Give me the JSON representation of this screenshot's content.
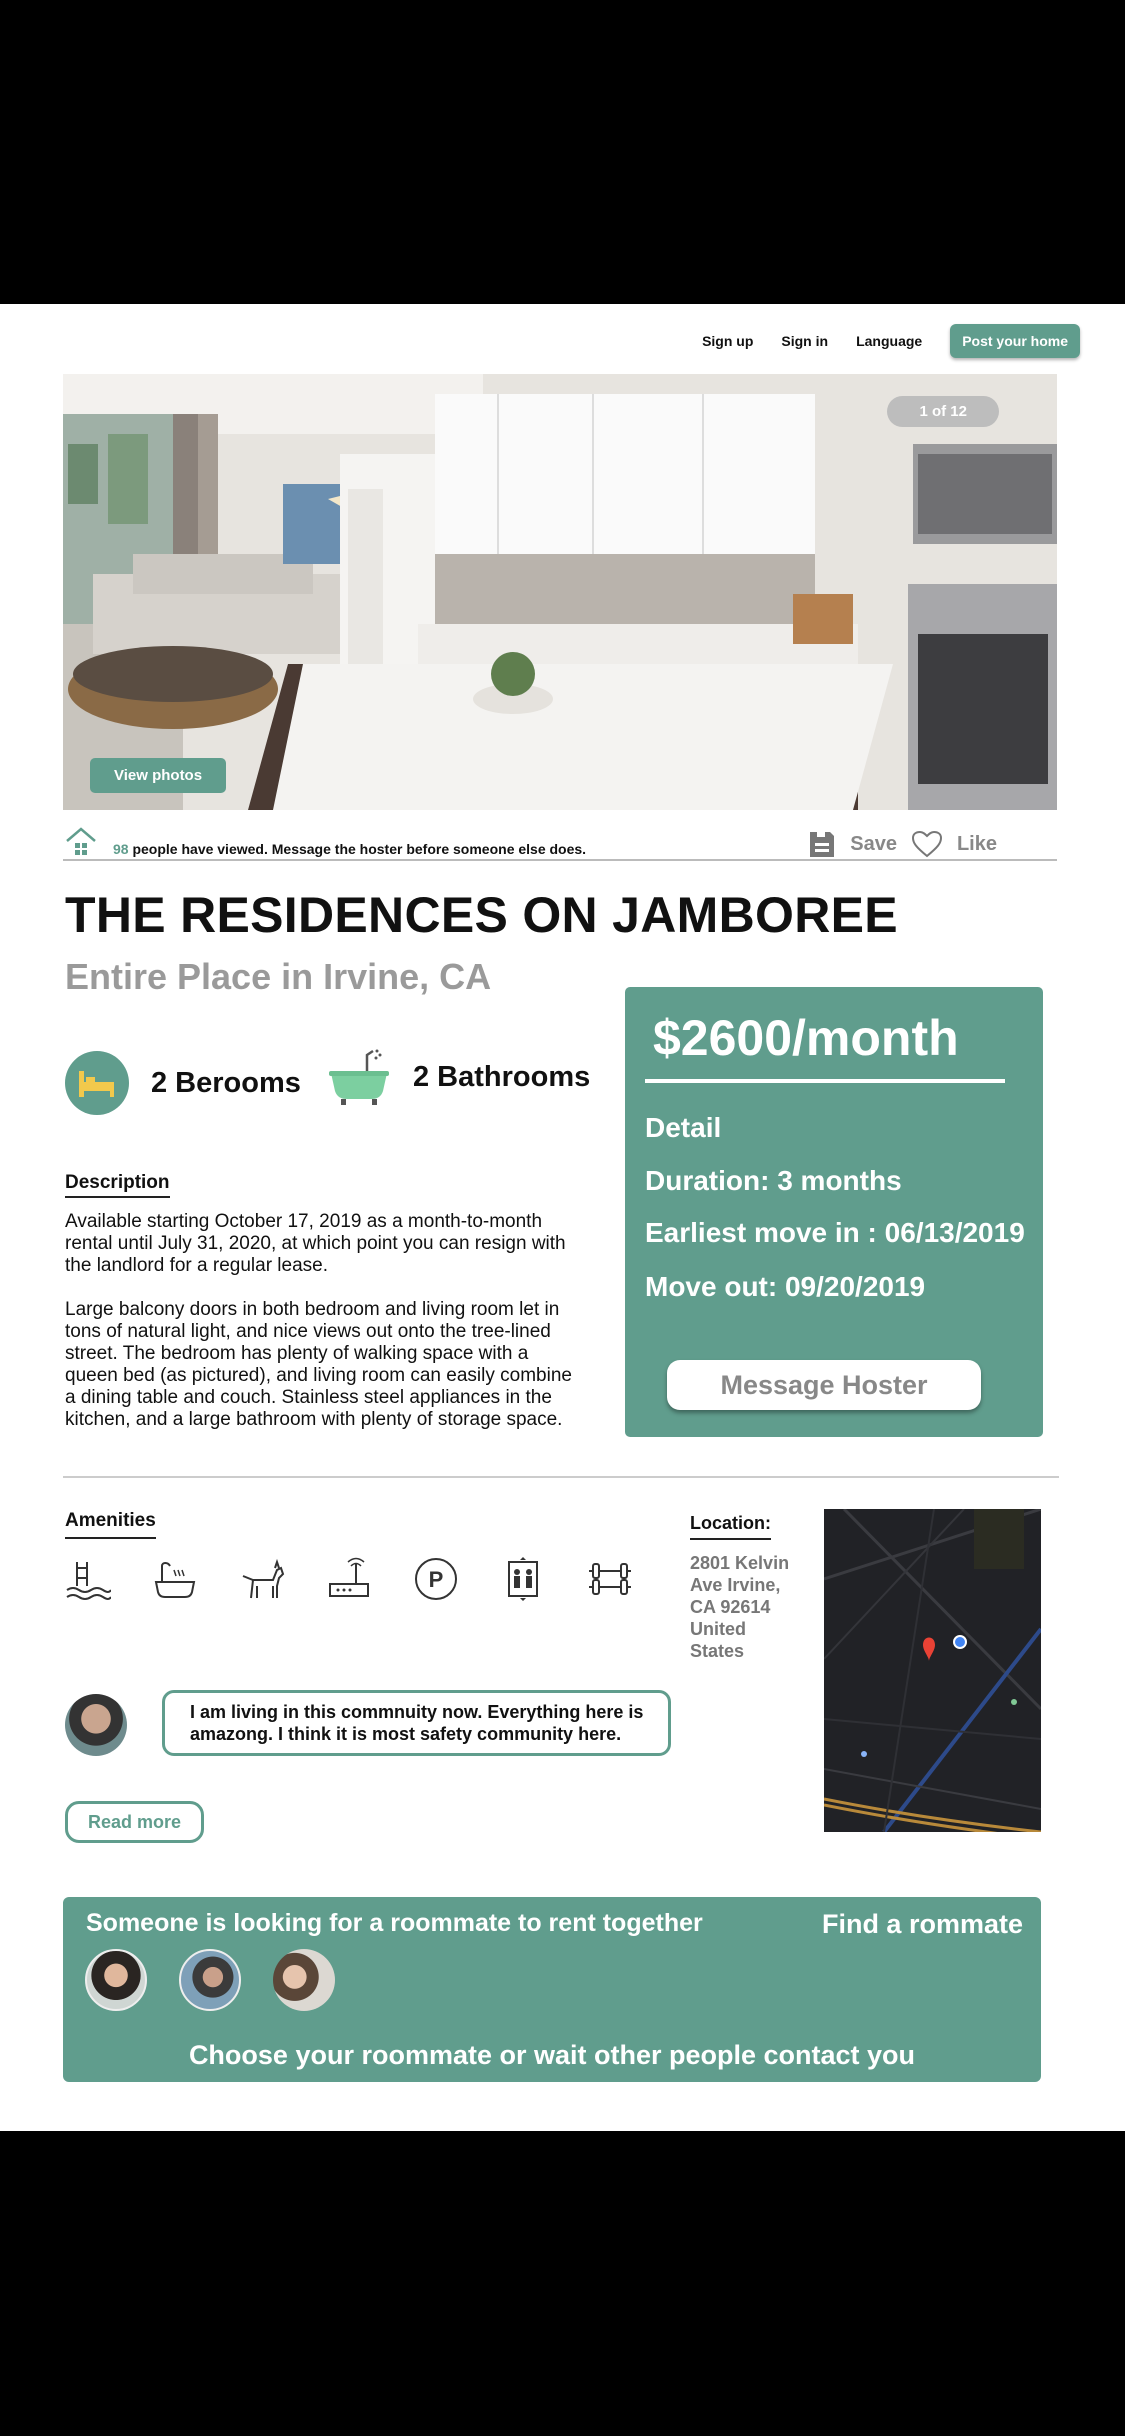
{
  "nav": {
    "signup": "Sign up",
    "signin": "Sign in",
    "language": "Language",
    "post": "Post your home"
  },
  "gallery": {
    "counter": "1 of 12",
    "view_photos": "View photos"
  },
  "views": {
    "count": "98",
    "text": "people have viewed. Message the hoster before someone else does.",
    "save": "Save",
    "like": "Like"
  },
  "listing": {
    "title": "THE RESIDENCES ON JAMBOREE",
    "subtitle": "Entire Place in Irvine, CA",
    "bedrooms": "2 Berooms",
    "bathrooms": "2 Bathrooms"
  },
  "description": {
    "heading": "Description",
    "p1": "Available starting October 17, 2019 as a month-to-month rental until July 31, 2020, at which point you can resign with the landlord for a regular lease.",
    "p2": " Large balcony doors in both bedroom and living room let in tons of natural light, and nice views out onto the tree-lined street. The bedroom has plenty of walking space with a queen bed (as pictured), and living room can easily combine a dining table and couch. Stainless steel appliances in the kitchen, and a large bathroom with plenty of storage space."
  },
  "price": {
    "amount": "$2600/month",
    "detail": "Detail",
    "duration": "Duration:  3 months",
    "move_in": "Earliest move in : 06/13/2019",
    "move_out": "Move out: 09/20/2019",
    "message": "Message Hoster"
  },
  "amenities": {
    "heading": "Amenities",
    "icons": [
      "pool-icon",
      "bathtub-icon",
      "pet-icon",
      "router-icon",
      "parking-icon",
      "elevator-icon",
      "gym-icon"
    ]
  },
  "review": {
    "text": "I am living in this commnuity now. Everything here is amazong. I think  it is most safety community here.",
    "read_more": "Read more"
  },
  "location": {
    "heading": "Location:",
    "address": "2801 Kelvin Ave Irvine, CA 92614 United States"
  },
  "roommate": {
    "headline": "Someone is looking for a roommate to rent together",
    "find": "Find a rommate",
    "cta": "Choose your roommate or wait other people contact you"
  },
  "colors": {
    "accent": "#609d8d",
    "muted": "#9a9a9a"
  }
}
